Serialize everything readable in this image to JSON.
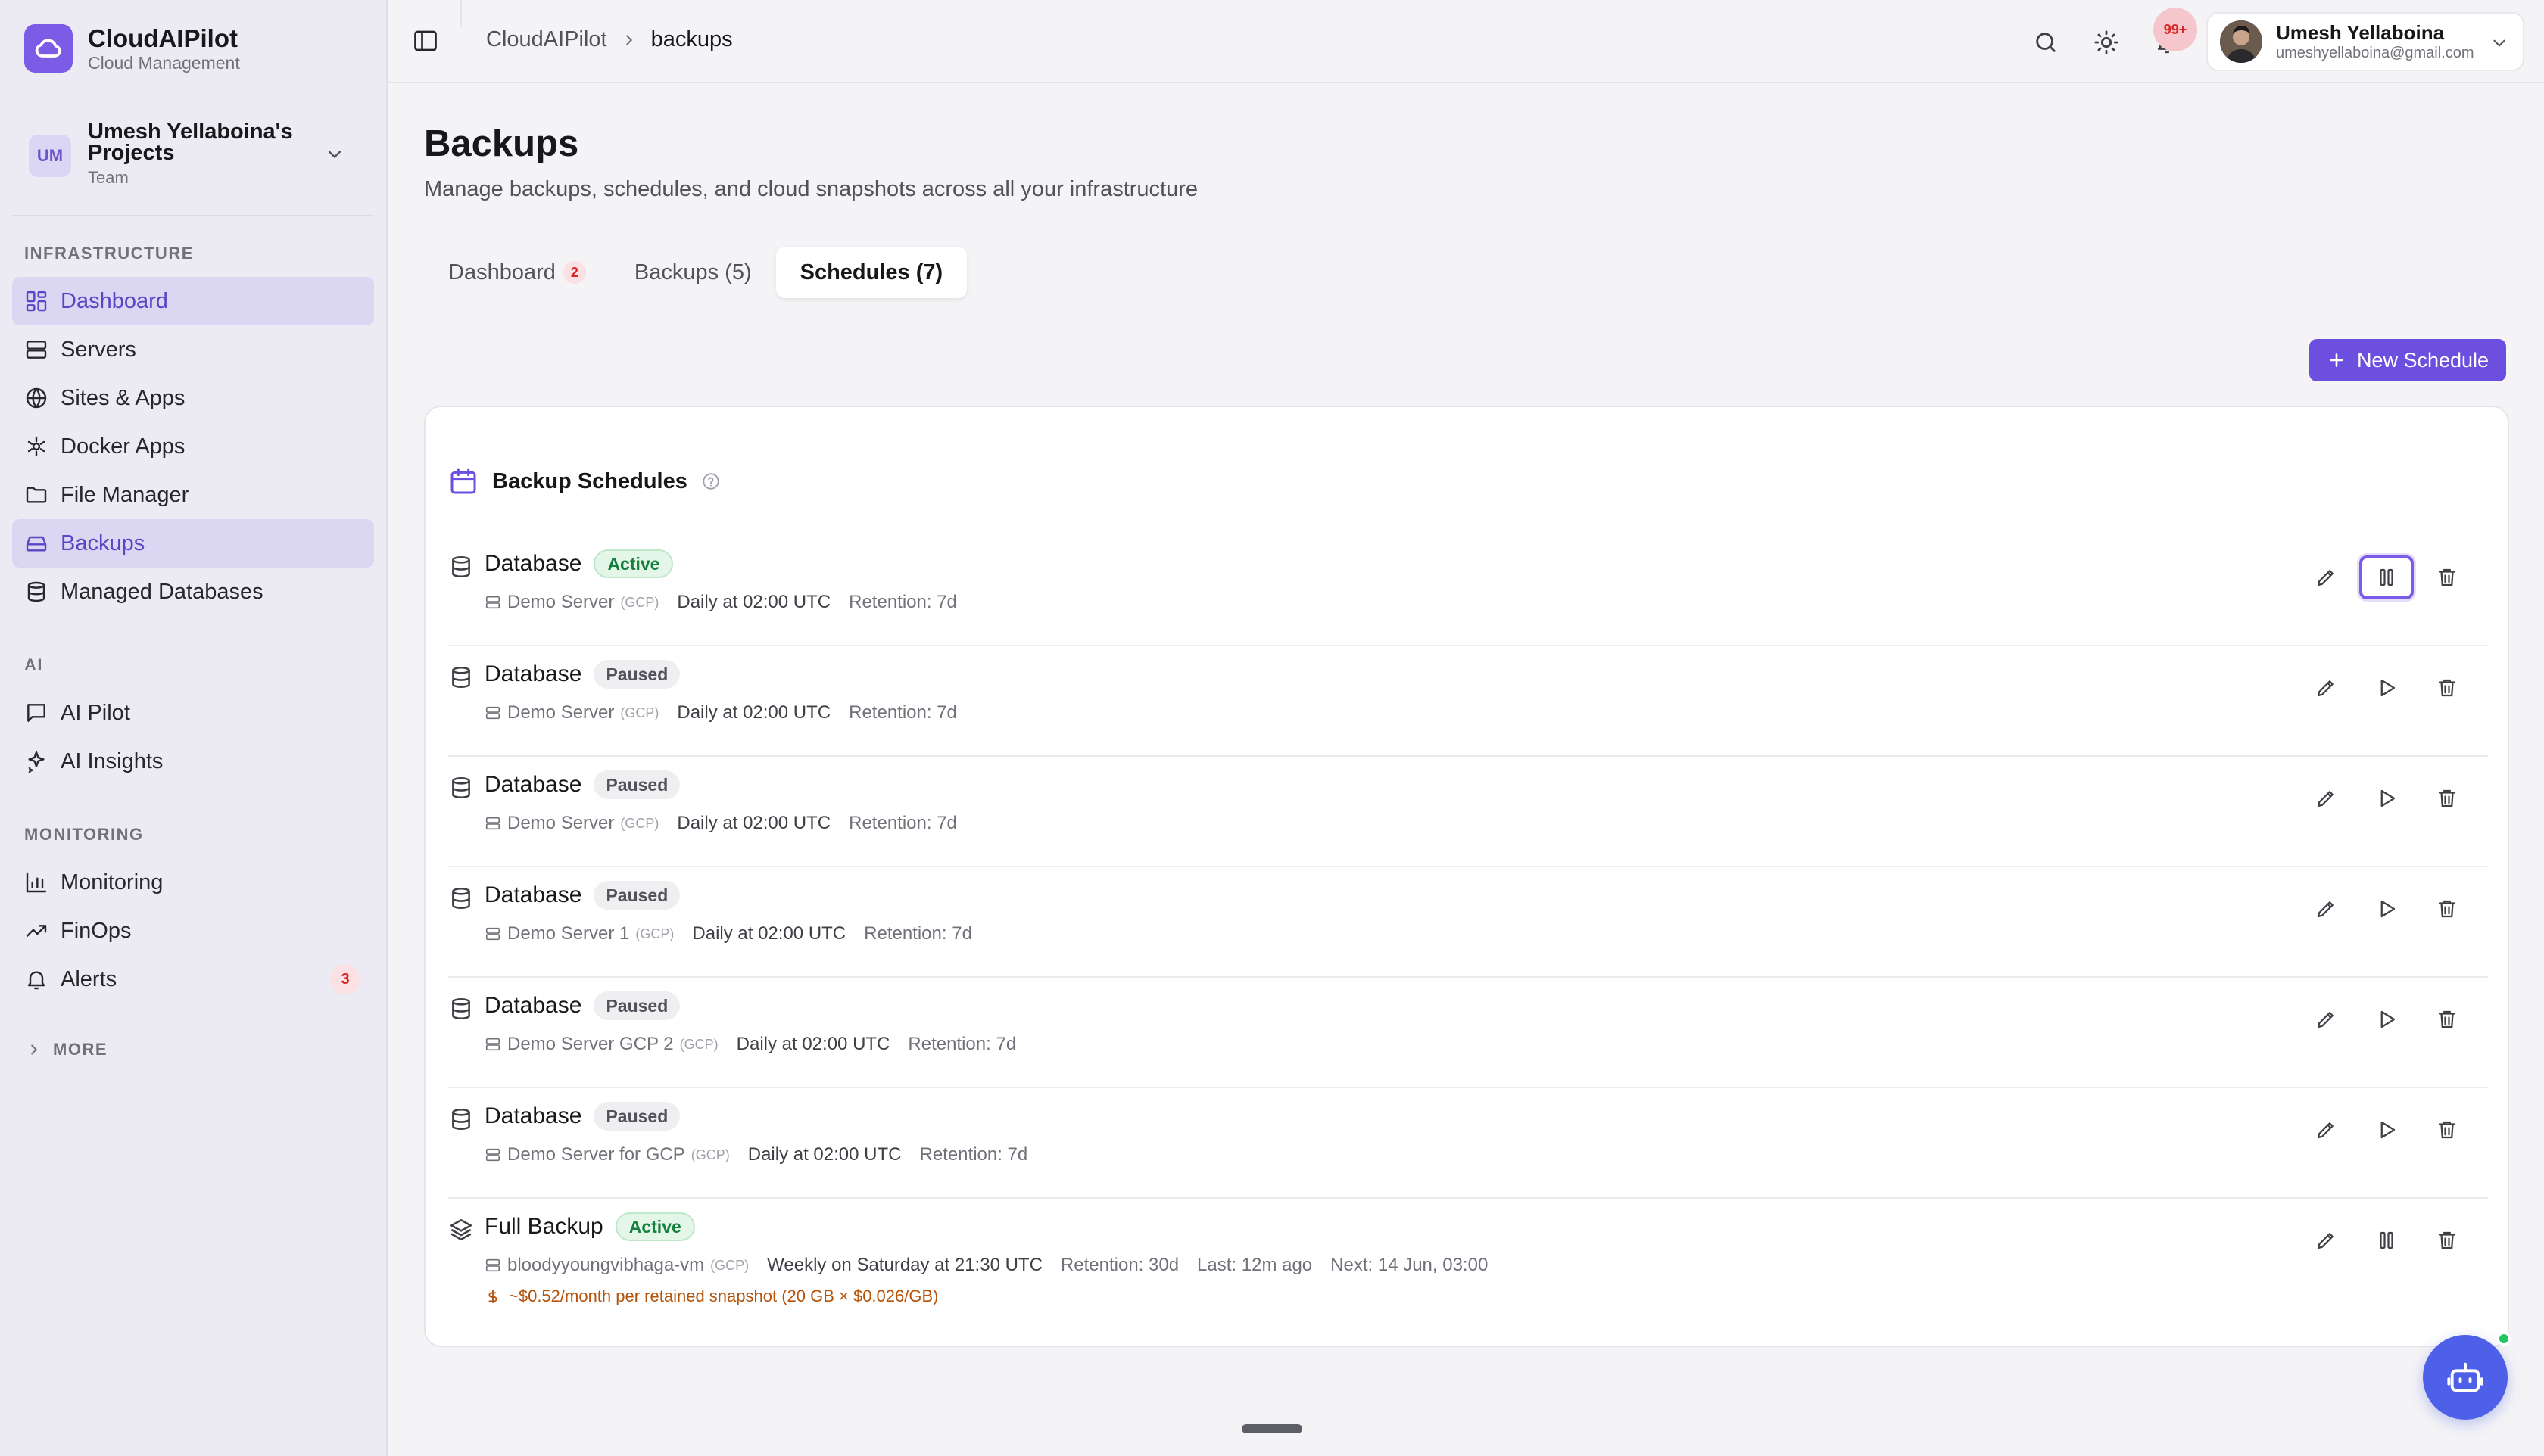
{
  "app": {
    "name": "CloudAIPilot",
    "subtitle": "Cloud Management"
  },
  "project": {
    "initials": "UM",
    "name": "Umesh Yellaboina's Projects",
    "team": "Team"
  },
  "sidebar": {
    "sections": [
      {
        "label": "INFRASTRUCTURE",
        "items": [
          {
            "label": "Dashboard",
            "icon": "dashboard-icon",
            "active": true
          },
          {
            "label": "Servers",
            "icon": "server-icon"
          },
          {
            "label": "Sites & Apps",
            "icon": "globe-icon"
          },
          {
            "label": "Docker Apps",
            "icon": "docker-icon"
          },
          {
            "label": "File Manager",
            "icon": "folder-icon"
          },
          {
            "label": "Backups",
            "icon": "backup-drive-icon",
            "active": true
          },
          {
            "label": "Managed Databases",
            "icon": "database-icon"
          }
        ]
      },
      {
        "label": "AI",
        "items": [
          {
            "label": "AI Pilot",
            "icon": "chat-icon"
          },
          {
            "label": "AI Insights",
            "icon": "sparkles-icon"
          }
        ]
      },
      {
        "label": "MONITORING",
        "items": [
          {
            "label": "Monitoring",
            "icon": "bar-chart-icon"
          },
          {
            "label": "FinOps",
            "icon": "trending-up-icon"
          },
          {
            "label": "Alerts",
            "icon": "bell-icon",
            "badge": "3"
          }
        ]
      }
    ],
    "more_label": "MORE"
  },
  "header": {
    "breadcrumb_root": "CloudAIPilot",
    "breadcrumb_current": "backups",
    "notification_badge": "99+",
    "user_name": "Umesh Yellaboina",
    "user_email": "umeshyellaboina@gmail.com"
  },
  "page": {
    "title": "Backups",
    "subtitle": "Manage backups, schedules, and cloud snapshots across all your infrastructure"
  },
  "tabs": [
    {
      "label": "Dashboard",
      "badge": "2"
    },
    {
      "label": "Backups (5)"
    },
    {
      "label": "Schedules (7)",
      "active": true
    }
  ],
  "new_schedule_label": "New Schedule",
  "card": {
    "title": "Backup Schedules"
  },
  "schedules": [
    {
      "name": "Database",
      "status": "Active",
      "server": "Demo Server",
      "cloud": "(GCP)",
      "schedule": "Daily at 02:00 UTC",
      "retention": "Retention: 7d",
      "toggle": "pause"
    },
    {
      "name": "Database",
      "status": "Paused",
      "server": "Demo Server",
      "cloud": "(GCP)",
      "schedule": "Daily at 02:00 UTC",
      "retention": "Retention: 7d",
      "toggle": "play"
    },
    {
      "name": "Database",
      "status": "Paused",
      "server": "Demo Server",
      "cloud": "(GCP)",
      "schedule": "Daily at 02:00 UTC",
      "retention": "Retention: 7d",
      "toggle": "play"
    },
    {
      "name": "Database",
      "status": "Paused",
      "server": "Demo Server 1",
      "cloud": "(GCP)",
      "schedule": "Daily at 02:00 UTC",
      "retention": "Retention: 7d",
      "toggle": "play"
    },
    {
      "name": "Database",
      "status": "Paused",
      "server": "Demo Server GCP 2",
      "cloud": "(GCP)",
      "schedule": "Daily at 02:00 UTC",
      "retention": "Retention: 7d",
      "toggle": "play"
    },
    {
      "name": "Database",
      "status": "Paused",
      "server": "Demo Server for GCP",
      "cloud": "(GCP)",
      "schedule": "Daily at 02:00 UTC",
      "retention": "Retention: 7d",
      "toggle": "play"
    },
    {
      "name": "Full Backup",
      "status": "Active",
      "server": "bloodyyoungvibhaga-vm",
      "cloud": "(GCP)",
      "schedule": "Weekly on Saturday at 21:30 UTC",
      "retention": "Retention: 30d",
      "last": "Last: 12m ago",
      "next": "Next: 14 Jun, 03:00",
      "cost": "~$0.52/month per retained snapshot (20 GB × $0.026/GB)",
      "toggle": "pause"
    }
  ],
  "colors": {
    "accent": "#6d4fe0",
    "active_green": "#15803d",
    "badge_red": "#dc2626",
    "cost_amber": "#b45309"
  }
}
